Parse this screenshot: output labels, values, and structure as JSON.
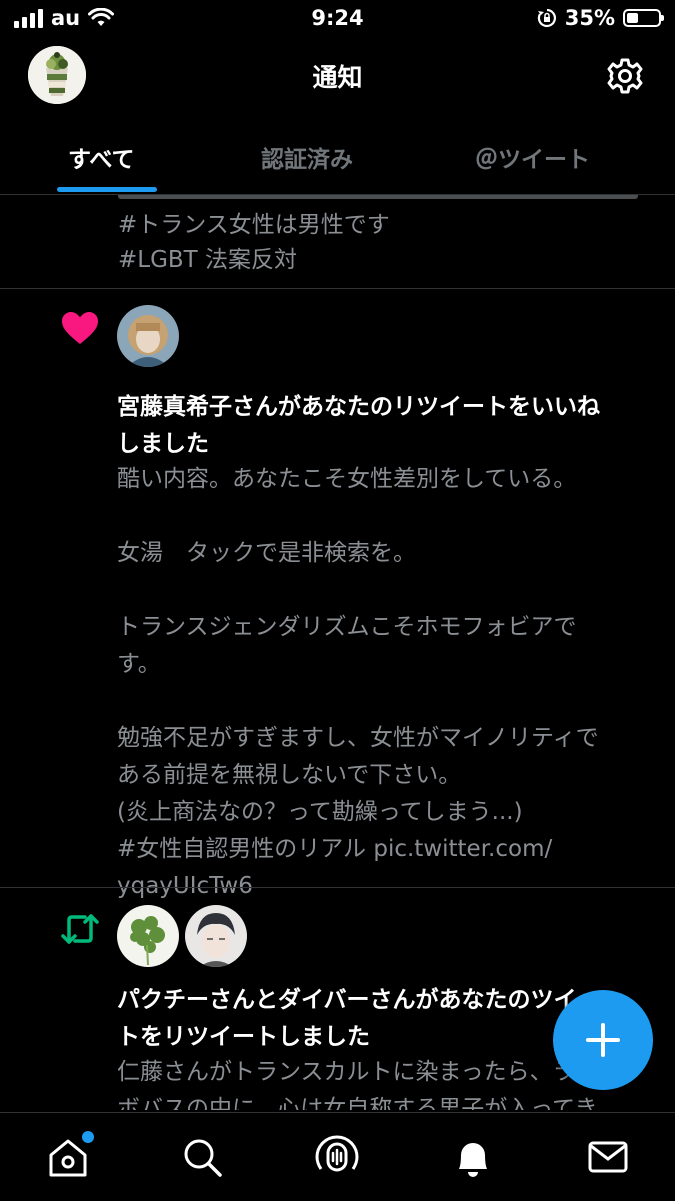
{
  "status_bar": {
    "carrier": "au",
    "time": "9:24",
    "battery_percent": "35%",
    "battery_level": 0.35
  },
  "header": {
    "title": "通知",
    "settings_icon": "gear-icon"
  },
  "tabs": [
    {
      "label": "すべて",
      "active": true
    },
    {
      "label": "認証済み",
      "active": false
    },
    {
      "label": "＠ツイート",
      "active": false
    }
  ],
  "notifications": [
    {
      "type": "partial",
      "lines": [
        "#トランス女性は男性です",
        "#LGBT 法案反対"
      ]
    },
    {
      "type": "like",
      "icon": "heart-icon",
      "title": "宮藤真希子さんがあなたのリツイートをいいね\nしました",
      "body": "酷い内容。あなたこそ女性差別をしている。\n\n女湯　タックで是非検索を。\n\nトランスジェンダリズムこそホモフォビアで\nす。\n\n勉強不足がすぎますし、女性がマイノリティで\nある前提を無視しないで下さい。\n(炎上商法なの？って勘繰ってしまう...)\n#女性自認男性のリアル pic.twitter.com/\nyqayUIcTw6"
    },
    {
      "type": "retweet",
      "icon": "retweet-icon",
      "title": "パクチーさんとダイバーさんがあなたのツイー\nトをリツイートしました",
      "body": "仁藤さんがトランスカルトに染まったら、ラ\nボバスの中に、心は女自称する男子が入ってき"
    }
  ],
  "fab": {
    "icon": "compose-plus-icon"
  },
  "bottom_nav": [
    {
      "name": "home",
      "icon": "home-icon",
      "has_badge": true
    },
    {
      "name": "search",
      "icon": "search-icon",
      "has_badge": false
    },
    {
      "name": "spaces",
      "icon": "spaces-icon",
      "has_badge": false
    },
    {
      "name": "notifications",
      "icon": "bell-icon",
      "has_badge": false
    },
    {
      "name": "messages",
      "icon": "mail-icon",
      "has_badge": false
    }
  ],
  "colors": {
    "accent": "#1d9bf0",
    "like": "#f91880",
    "retweet": "#00ba7c",
    "secondary_text": "#8b8f94",
    "divider": "#2f3336"
  }
}
